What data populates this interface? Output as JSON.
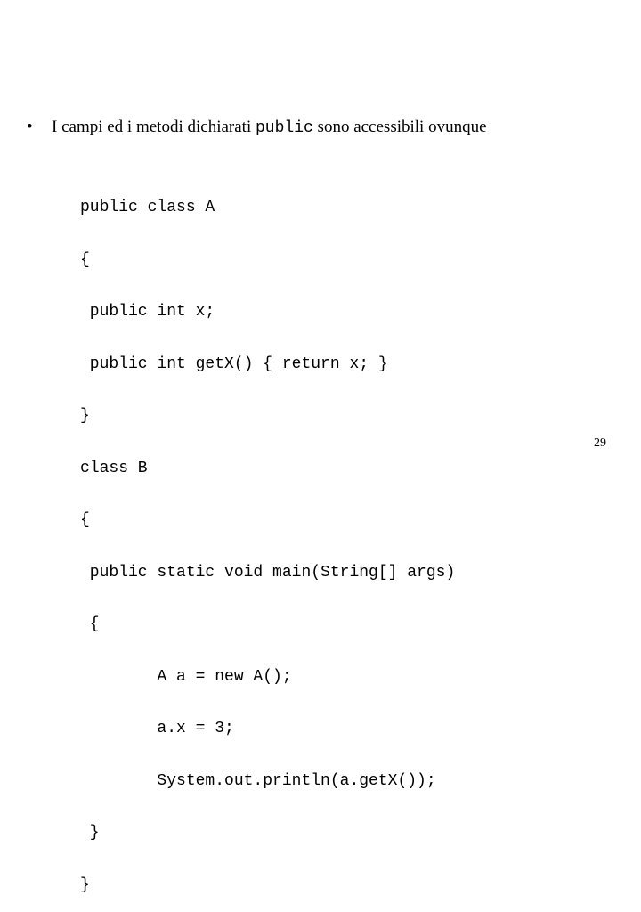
{
  "slide": {
    "bullet": {
      "marker": "•",
      "text_before": "I campi ed i metodi dichiarati ",
      "code_keyword": "public",
      "text_after": " sono accessibili ovunque"
    },
    "code_lines": [
      "public class A",
      "{",
      " public int x;",
      " public int getX() { return x; }",
      "}",
      "class B",
      "{",
      " public static void main(String[] args)",
      " {",
      "        A a = new A();",
      "        a.x = 3;",
      "        System.out.println(a.getX());",
      " }",
      "}"
    ],
    "page_number": "29"
  }
}
